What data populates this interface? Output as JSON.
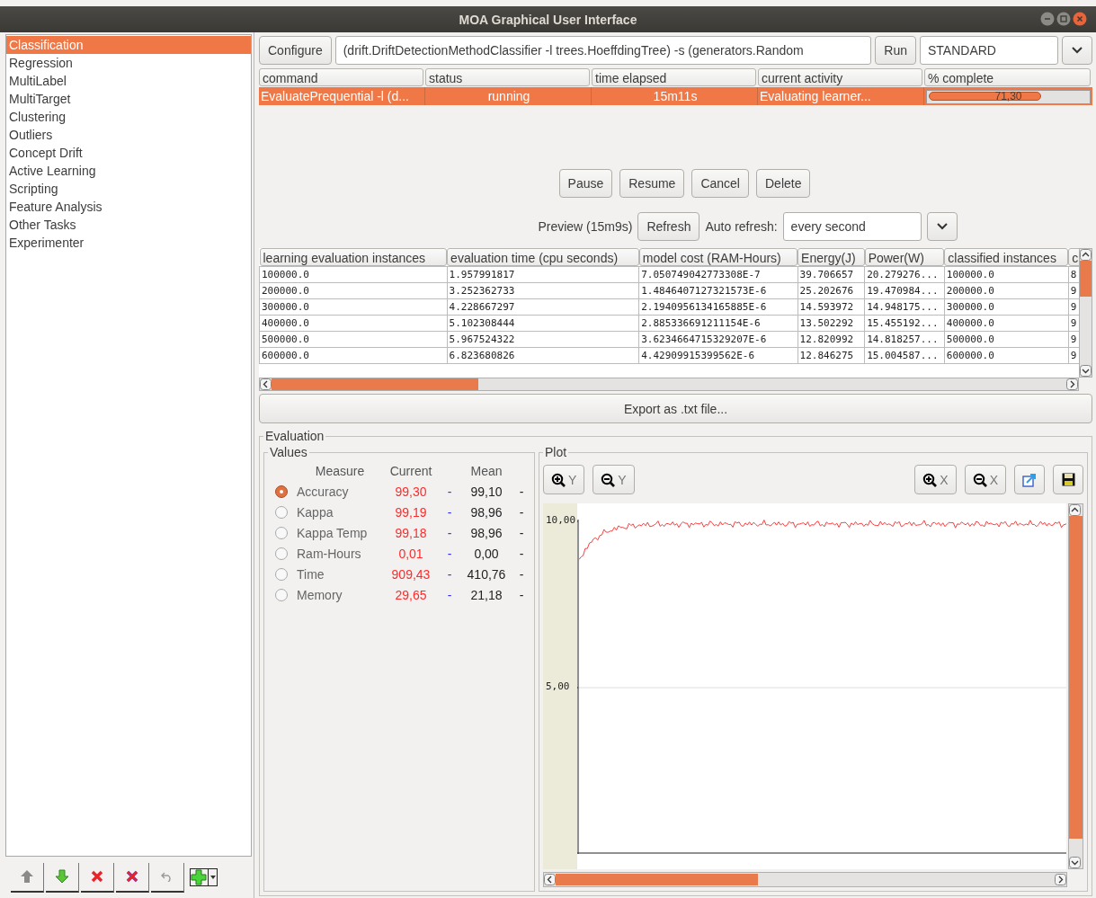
{
  "window": {
    "title": "MOA Graphical User Interface"
  },
  "sidebar": {
    "items": [
      {
        "label": "Classification",
        "selected": true
      },
      {
        "label": "Regression",
        "selected": false
      },
      {
        "label": "MultiLabel",
        "selected": false
      },
      {
        "label": "MultiTarget",
        "selected": false
      },
      {
        "label": "Clustering",
        "selected": false
      },
      {
        "label": "Outliers",
        "selected": false
      },
      {
        "label": "Concept Drift",
        "selected": false
      },
      {
        "label": "Active Learning",
        "selected": false
      },
      {
        "label": "Scripting",
        "selected": false
      },
      {
        "label": "Feature Analysis",
        "selected": false
      },
      {
        "label": "Other Tasks",
        "selected": false
      },
      {
        "label": "Experimenter",
        "selected": false
      }
    ]
  },
  "task_bar": {
    "configure_button": "Configure",
    "command": "(drift.DriftDetectionMethodClassifier -l trees.HoeffdingTree) -s (generators.Random",
    "run_button": "Run",
    "mode": "STANDARD"
  },
  "tasks": {
    "columns": [
      "command",
      "status",
      "time elapsed",
      "current activity",
      "% complete"
    ],
    "rows": [
      {
        "command": "EvaluatePrequential -l (d...",
        "status": "running",
        "time_elapsed": "15m11s",
        "current_activity": "Evaluating learner...",
        "progress_label": "71,30",
        "level": 0.713,
        "selected": true
      }
    ]
  },
  "task_buttons": [
    "Pause",
    "Resume",
    "Cancel",
    "Delete"
  ],
  "preview": {
    "label": "Preview (15m9s)",
    "refresh_button": "Refresh",
    "auto_refresh_label": "Auto refresh:",
    "auto_refresh_value": "every second"
  },
  "results": {
    "columns": [
      "learning evaluation instances",
      "evaluation time (cpu seconds)",
      "model cost (RAM-Hours)",
      "Energy(J)",
      "Power(W)",
      "classified instances",
      "c"
    ],
    "rows": [
      [
        "100000.0",
        "1.957991817",
        "7.050749042773308E-7",
        "39.706657",
        "20.279276...",
        "100000.0",
        "8"
      ],
      [
        "200000.0",
        "3.252362733",
        "1.4846407127321573E-6",
        "25.202676",
        "19.470984...",
        "200000.0",
        "9"
      ],
      [
        "300000.0",
        "4.228667297",
        "2.1940956134165885E-6",
        "14.593972",
        "14.948175...",
        "300000.0",
        "9"
      ],
      [
        "400000.0",
        "5.102308444",
        "2.885336691211154E-6",
        "13.502292",
        "15.455192...",
        "400000.0",
        "9"
      ],
      [
        "500000.0",
        "5.967524322",
        "3.6234664715329207E-6",
        "12.820992",
        "14.818257...",
        "500000.0",
        "9"
      ],
      [
        "600000.0",
        "6.823680826",
        "4.42909915399562E-6",
        "12.846275",
        "15.004587...",
        "600000.0",
        "9"
      ]
    ]
  },
  "export_button": "Export as .txt file...",
  "evaluation": {
    "title": "Evaluation",
    "values": {
      "title": "Values",
      "headers": [
        "Measure",
        "Current",
        "Mean"
      ],
      "measures": [
        {
          "name": "Accuracy",
          "current": "99,30",
          "current_mark": "-",
          "mean": "99,10",
          "mean_mark": "-",
          "selected": true
        },
        {
          "name": "Kappa",
          "current": "99,19",
          "current_mark": "-",
          "mean": "98,96",
          "mean_mark": "-",
          "selected": false
        },
        {
          "name": "Kappa Temp",
          "current": "99,18",
          "current_mark": "-",
          "mean": "98,96",
          "mean_mark": "-",
          "selected": false
        },
        {
          "name": "Ram-Hours",
          "current": "0,01",
          "current_mark": "-",
          "mean": "0,00",
          "mean_mark": "-",
          "selected": false
        },
        {
          "name": "Time",
          "current": "909,43",
          "current_mark": "-",
          "mean": "410,76",
          "mean_mark": "-",
          "selected": false
        },
        {
          "name": "Memory",
          "current": "29,65",
          "current_mark": "-",
          "mean": "21,18",
          "mean_mark": "-",
          "selected": false
        }
      ]
    },
    "plot": {
      "title": "Plot",
      "zoom_buttons": [
        {
          "kind": "zoom-in",
          "axis": "Y"
        },
        {
          "kind": "zoom-out",
          "axis": "Y"
        },
        {
          "kind": "zoom-in",
          "axis": "X"
        },
        {
          "kind": "zoom-out",
          "axis": "X"
        }
      ],
      "y_tick_labels": [
        "10,00",
        "5,00"
      ]
    }
  }
}
